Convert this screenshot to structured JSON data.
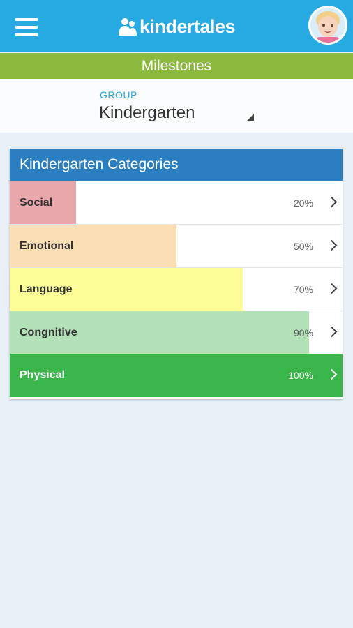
{
  "app": {
    "brand": "kindertales"
  },
  "header": {
    "menu_icon": "hamburger-menu-icon",
    "avatar_icon": "child-avatar"
  },
  "section": {
    "title": "Milestones"
  },
  "group": {
    "label": "GROUP",
    "value": "Kindergarten"
  },
  "card": {
    "title": "Kindergarten Categories",
    "categories": [
      {
        "name": "Social",
        "percent_label": "20%",
        "progress": 0.2,
        "color": "#e8a7ab"
      },
      {
        "name": "Emotional",
        "percent_label": "50%",
        "progress": 0.5,
        "color": "#fbdeb4"
      },
      {
        "name": "Language",
        "percent_label": "70%",
        "progress": 0.7,
        "color": "#fefe99"
      },
      {
        "name": "Congnitive",
        "percent_label": "90%",
        "progress": 0.9,
        "color": "#b3e1b8"
      },
      {
        "name": "Physical",
        "percent_label": "100%",
        "progress": 1.0,
        "color": "#3ab54a"
      }
    ]
  },
  "colors": {
    "topbar": "#27a9e1",
    "section_bar": "#8cba3f",
    "card_header": "#2b7ec0",
    "accent": "#27a9e1"
  }
}
